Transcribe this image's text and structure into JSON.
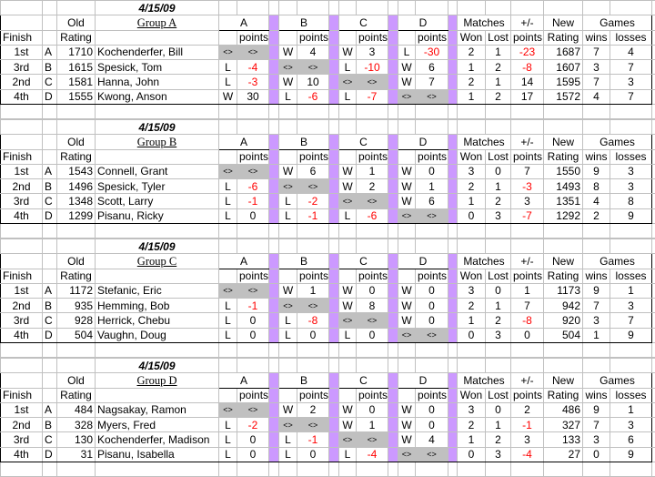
{
  "headers": {
    "old": "Old",
    "finish": "Finish",
    "rating": "Rating",
    "points": "points",
    "matches": "Matches",
    "won": "Won",
    "lost": "Lost",
    "plusminus": "+/-",
    "new": "New",
    "games": "Games",
    "wins": "wins",
    "losses": "losses",
    "opponents": [
      "A",
      "B",
      "C",
      "D"
    ]
  },
  "colors": {
    "divider": "#cc99ff",
    "self_cell": "#c0c0c0",
    "negative": "#ff0000"
  },
  "groups": [
    {
      "date": "4/15/09",
      "title": "Group A",
      "rows": [
        {
          "finish": "1st",
          "letter": "A",
          "old": "1710",
          "name": "Kochenderfer, Bill",
          "results": [
            [
              "<>",
              "<>"
            ],
            [
              "W",
              "4"
            ],
            [
              "W",
              "3"
            ],
            [
              "L",
              "-30"
            ]
          ],
          "won": "2",
          "lost": "1",
          "diff": "-23",
          "new": "1687",
          "wins": "7",
          "losses": "4"
        },
        {
          "finish": "3rd",
          "letter": "B",
          "old": "1615",
          "name": "Spesick, Tom",
          "results": [
            [
              "L",
              "-4"
            ],
            [
              "<>",
              "<>"
            ],
            [
              "L",
              "-10"
            ],
            [
              "W",
              "6"
            ]
          ],
          "won": "1",
          "lost": "2",
          "diff": "-8",
          "new": "1607",
          "wins": "3",
          "losses": "7"
        },
        {
          "finish": "2nd",
          "letter": "C",
          "old": "1581",
          "name": "Hanna, John",
          "results": [
            [
              "L",
              "-3"
            ],
            [
              "W",
              "10"
            ],
            [
              "<>",
              "<>"
            ],
            [
              "W",
              "7"
            ]
          ],
          "won": "2",
          "lost": "1",
          "diff": "14",
          "new": "1595",
          "wins": "7",
          "losses": "3"
        },
        {
          "finish": "4th",
          "letter": "D",
          "old": "1555",
          "name": "Kwong, Anson",
          "results": [
            [
              "W",
              "30"
            ],
            [
              "L",
              "-6"
            ],
            [
              "L",
              "-7"
            ],
            [
              "<>",
              "<>"
            ]
          ],
          "won": "1",
          "lost": "2",
          "diff": "17",
          "new": "1572",
          "wins": "4",
          "losses": "7"
        }
      ]
    },
    {
      "date": "4/15/09",
      "title": "Group B",
      "rows": [
        {
          "finish": "1st",
          "letter": "A",
          "old": "1543",
          "name": "Connell, Grant",
          "results": [
            [
              "<>",
              "<>"
            ],
            [
              "W",
              "6"
            ],
            [
              "W",
              "1"
            ],
            [
              "W",
              "0"
            ]
          ],
          "won": "3",
          "lost": "0",
          "diff": "7",
          "new": "1550",
          "wins": "9",
          "losses": "3"
        },
        {
          "finish": "2nd",
          "letter": "B",
          "old": "1496",
          "name": "Spesick, Tyler",
          "results": [
            [
              "L",
              "-6"
            ],
            [
              "<>",
              "<>"
            ],
            [
              "W",
              "2"
            ],
            [
              "W",
              "1"
            ]
          ],
          "won": "2",
          "lost": "1",
          "diff": "-3",
          "new": "1493",
          "wins": "8",
          "losses": "3"
        },
        {
          "finish": "3rd",
          "letter": "C",
          "old": "1348",
          "name": "Scott, Larry",
          "results": [
            [
              "L",
              "-1"
            ],
            [
              "L",
              "-2"
            ],
            [
              "<>",
              "<>"
            ],
            [
              "W",
              "6"
            ]
          ],
          "won": "1",
          "lost": "2",
          "diff": "3",
          "new": "1351",
          "wins": "4",
          "losses": "8"
        },
        {
          "finish": "4th",
          "letter": "D",
          "old": "1299",
          "name": "Pisanu, Ricky",
          "results": [
            [
              "L",
              "0"
            ],
            [
              "L",
              "-1"
            ],
            [
              "L",
              "-6"
            ],
            [
              "<>",
              "<>"
            ]
          ],
          "won": "0",
          "lost": "3",
          "diff": "-7",
          "new": "1292",
          "wins": "2",
          "losses": "9"
        }
      ]
    },
    {
      "date": "4/15/09",
      "title": "Group C",
      "rows": [
        {
          "finish": "1st",
          "letter": "A",
          "old": "1172",
          "name": "Stefanic, Eric",
          "results": [
            [
              "<>",
              "<>"
            ],
            [
              "W",
              "1"
            ],
            [
              "W",
              "0"
            ],
            [
              "W",
              "0"
            ]
          ],
          "won": "3",
          "lost": "0",
          "diff": "1",
          "new": "1173",
          "wins": "9",
          "losses": "1"
        },
        {
          "finish": "2nd",
          "letter": "B",
          "old": "935",
          "name": "Hemming, Bob",
          "results": [
            [
              "L",
              "-1"
            ],
            [
              "<>",
              "<>"
            ],
            [
              "W",
              "8"
            ],
            [
              "W",
              "0"
            ]
          ],
          "won": "2",
          "lost": "1",
          "diff": "7",
          "new": "942",
          "wins": "7",
          "losses": "3"
        },
        {
          "finish": "3rd",
          "letter": "C",
          "old": "928",
          "name": "Herrick, Chebu",
          "results": [
            [
              "L",
              "0"
            ],
            [
              "L",
              "-8"
            ],
            [
              "<>",
              "<>"
            ],
            [
              "W",
              "0"
            ]
          ],
          "won": "1",
          "lost": "2",
          "diff": "-8",
          "new": "920",
          "wins": "3",
          "losses": "7"
        },
        {
          "finish": "4th",
          "letter": "D",
          "old": "504",
          "name": "Vaughn, Doug",
          "results": [
            [
              "L",
              "0"
            ],
            [
              "L",
              "0"
            ],
            [
              "L",
              "0"
            ],
            [
              "<>",
              "<>"
            ]
          ],
          "won": "0",
          "lost": "3",
          "diff": "0",
          "new": "504",
          "wins": "1",
          "losses": "9"
        }
      ]
    },
    {
      "date": "4/15/09",
      "title": "Group D",
      "rows": [
        {
          "finish": "1st",
          "letter": "A",
          "old": "484",
          "name": "Nagsakay, Ramon",
          "results": [
            [
              "<>",
              "<>"
            ],
            [
              "W",
              "2"
            ],
            [
              "W",
              "0"
            ],
            [
              "W",
              "0"
            ]
          ],
          "won": "3",
          "lost": "0",
          "diff": "2",
          "new": "486",
          "wins": "9",
          "losses": "1"
        },
        {
          "finish": "2nd",
          "letter": "B",
          "old": "328",
          "name": "Myers, Fred",
          "results": [
            [
              "L",
              "-2"
            ],
            [
              "<>",
              "<>"
            ],
            [
              "W",
              "1"
            ],
            [
              "W",
              "0"
            ]
          ],
          "won": "2",
          "lost": "1",
          "diff": "-1",
          "new": "327",
          "wins": "7",
          "losses": "3"
        },
        {
          "finish": "3rd",
          "letter": "C",
          "old": "130",
          "name": "Kochenderfer, Madison",
          "results": [
            [
              "L",
              "0"
            ],
            [
              "L",
              "-1"
            ],
            [
              "<>",
              "<>"
            ],
            [
              "W",
              "4"
            ]
          ],
          "won": "1",
          "lost": "2",
          "diff": "3",
          "new": "133",
          "wins": "3",
          "losses": "6"
        },
        {
          "finish": "4th",
          "letter": "D",
          "old": "31",
          "name": "Pisanu, Isabella",
          "results": [
            [
              "L",
              "0"
            ],
            [
              "L",
              "0"
            ],
            [
              "L",
              "-4"
            ],
            [
              "<>",
              "<>"
            ]
          ],
          "won": "0",
          "lost": "3",
          "diff": "-4",
          "new": "27",
          "wins": "0",
          "losses": "9"
        }
      ]
    }
  ]
}
